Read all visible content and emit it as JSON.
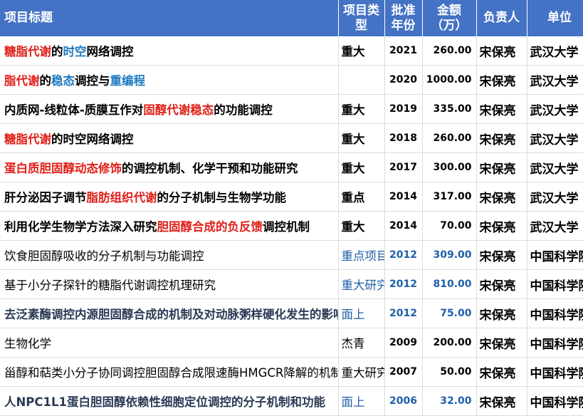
{
  "headers": {
    "title": "项目标题",
    "type_l1": "项目类",
    "type_l2": "型",
    "year_l1": "批准",
    "year_l2": "年份",
    "amount_l1": "金额",
    "amount_l2": "（万）",
    "person": "负责人",
    "unit": "单位"
  },
  "colors": {
    "header_bg": "#4472c4",
    "highlight_red": "#e0201b",
    "highlight_blue": "#1f7bc1",
    "value_blue": "#1f5fa8"
  },
  "rows": [
    {
      "title": [
        [
          "糖脂代谢",
          "r"
        ],
        [
          "的",
          "n"
        ],
        [
          "时空",
          "b"
        ],
        [
          "网络调控",
          "n"
        ]
      ],
      "type": "重大",
      "year": "2021",
      "amount": "260.00",
      "person": "宋保亮",
      "unit": "武汉大学"
    },
    {
      "title": [
        [
          "脂代谢",
          "r"
        ],
        [
          "的",
          "n"
        ],
        [
          "稳态",
          "b"
        ],
        [
          "调控与",
          "n"
        ],
        [
          "重编程",
          "b"
        ]
      ],
      "type": "",
      "year": "2020",
      "amount": "1000.00",
      "person": "宋保亮",
      "unit": "武汉大学"
    },
    {
      "title": [
        [
          "内质网-线粒体-质膜互作对",
          "n"
        ],
        [
          "固醇代谢稳态",
          "r"
        ],
        [
          "的功能调控",
          "n"
        ]
      ],
      "type": "重大",
      "year": "2019",
      "amount": "335.00",
      "person": "宋保亮",
      "unit": "武汉大学"
    },
    {
      "title": [
        [
          "糖脂代谢",
          "r"
        ],
        [
          "的时空网络调控",
          "n"
        ]
      ],
      "type": "重大",
      "year": "2018",
      "amount": "260.00",
      "person": "宋保亮",
      "unit": "武汉大学"
    },
    {
      "title": [
        [
          "蛋白质胆固醇动态修饰",
          "r"
        ],
        [
          "的调控机制、化学干预和功能研究",
          "n"
        ]
      ],
      "type": "重大",
      "year": "2017",
      "amount": "300.00",
      "person": "宋保亮",
      "unit": "武汉大学"
    },
    {
      "title": [
        [
          "肝分泌因子调节",
          "n"
        ],
        [
          "脂肪组织代谢",
          "r"
        ],
        [
          "的分子机制与生物学功能",
          "n"
        ]
      ],
      "type": "重点",
      "year": "2014",
      "amount": "317.00",
      "person": "宋保亮",
      "unit": "武汉大学"
    },
    {
      "title": [
        [
          "利用化学生物学方法深入研究",
          "n"
        ],
        [
          "胆固醇合成的负反馈",
          "r"
        ],
        [
          "调控机制",
          "n"
        ]
      ],
      "type": "重大",
      "year": "2014",
      "amount": "70.00",
      "person": "宋保亮",
      "unit": "武汉大学"
    },
    {
      "title": [
        [
          "饮食胆固醇吸收的分子机制与功能调控",
          "n"
        ]
      ],
      "type": "重点项目",
      "year": "2012",
      "amount": "309.00",
      "person": "宋保亮",
      "unit": "中国科学院"
    },
    {
      "title": [
        [
          "基于小分子探针的糖脂代谢调控机理研究",
          "n"
        ]
      ],
      "type": "重大研究",
      "year": "2012",
      "amount": "810.00",
      "person": "宋保亮",
      "unit": "中国科学院"
    },
    {
      "title": [
        [
          "去泛素酶调控内源胆固醇合成的机制及对动脉粥样硬化发生的影响",
          "n"
        ]
      ],
      "type": "面上",
      "year": "2012",
      "amount": "75.00",
      "person": "宋保亮",
      "unit": "中国科学院"
    },
    {
      "title": [
        [
          "生物化学",
          "n"
        ]
      ],
      "type": "杰青",
      "year": "2009",
      "amount": "200.00",
      "person": "宋保亮",
      "unit": "中国科学院"
    },
    {
      "title": [
        [
          "甾醇和萜类小分子协同调控胆固醇合成限速酶HMGCR降解的机制",
          "n"
        ]
      ],
      "type": "重大研究",
      "year": "2007",
      "amount": "50.00",
      "person": "宋保亮",
      "unit": "中国科学院"
    },
    {
      "title": [
        [
          "人NPC1L1蛋白胆固醇依赖性细胞定位调控的分子机制和功能",
          "n"
        ]
      ],
      "type": "面上",
      "year": "2006",
      "amount": "32.00",
      "person": "宋保亮",
      "unit": "中国科学院"
    }
  ]
}
